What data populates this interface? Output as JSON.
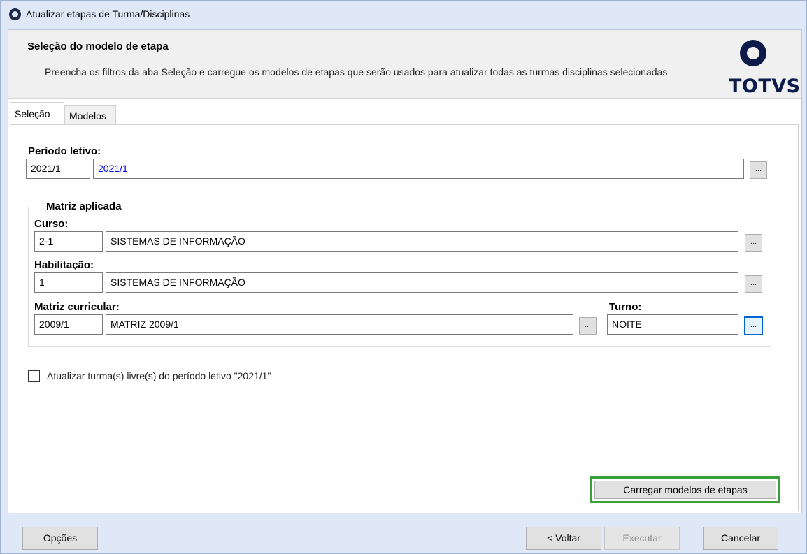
{
  "window": {
    "title": "Atualizar etapas de Turma/Disciplinas"
  },
  "header": {
    "title": "Seleção do modelo de etapa",
    "description": "Preencha os filtros da aba Seleção e carregue os modelos de etapas que serão usados para atualizar todas as turmas disciplinas selecionadas",
    "logo_text": "TOTVS"
  },
  "tabs": [
    {
      "label": "Seleção",
      "active": true
    },
    {
      "label": "Modelos",
      "active": false
    }
  ],
  "periodo": {
    "label": "Período letivo:",
    "code": "2021/1",
    "description": "2021/1"
  },
  "matriz": {
    "group_title": "Matriz aplicada",
    "curso": {
      "label": "Curso:",
      "code": "2-1",
      "description": "SISTEMAS DE INFORMAÇÃO"
    },
    "habilitacao": {
      "label": "Habilitação:",
      "code": "1",
      "description": "SISTEMAS DE INFORMAÇÃO"
    },
    "matriz_curricular": {
      "label": "Matriz curricular:",
      "code": "2009/1",
      "description": "MATRIZ 2009/1"
    },
    "turno": {
      "label": "Turno:",
      "value": "NOITE"
    }
  },
  "lookup_label": "...",
  "checkbox": {
    "label": "Atualizar turma(s) livre(s) do período letivo \"2021/1\"",
    "checked": false
  },
  "load_button": "Carregar modelos de etapas",
  "footer": {
    "options": "Opções",
    "back": "< Voltar",
    "execute": "Executar",
    "cancel": "Cancelar"
  },
  "colors": {
    "highlight_outline": "#3aa03a",
    "brand": "#0c1b4a",
    "focus": "#0063d1"
  }
}
